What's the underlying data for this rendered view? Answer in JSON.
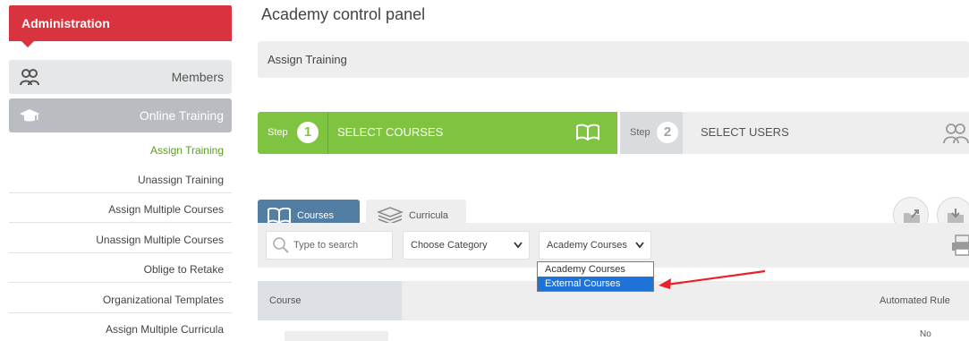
{
  "sidebar": {
    "header": "Administration",
    "members": "Members",
    "online_training": "Online Training",
    "sub_items": [
      "Assign Training",
      "Unassign Training",
      "Assign Multiple Courses",
      "Unassign Multiple Courses",
      "Oblige to Retake",
      "Organizational Templates",
      "Assign Multiple Curricula"
    ]
  },
  "main": {
    "title": "Academy control panel",
    "breadcrumb": "Assign Training",
    "steps": [
      {
        "label": "Step",
        "number": "1",
        "title": "SELECT COURSES"
      },
      {
        "label": "Step",
        "number": "2",
        "title": "SELECT USERS"
      }
    ],
    "tabs": {
      "courses": "Courses",
      "curricula": "Curricula"
    },
    "filters": {
      "search_placeholder": "Type to search",
      "category": "Choose Category",
      "source": "Academy Courses"
    },
    "dropdown_options": [
      "Academy Courses",
      "External Courses"
    ],
    "table": {
      "col_course": "Course",
      "col_rule": "Automated Rule",
      "row_value": "No"
    }
  },
  "colors": {
    "admin_red": "#d9333f",
    "step_green": "#7fc441",
    "tab_blue": "#527ea3",
    "highlight_blue": "#1e73d9",
    "arrow_red": "#e8212b"
  }
}
